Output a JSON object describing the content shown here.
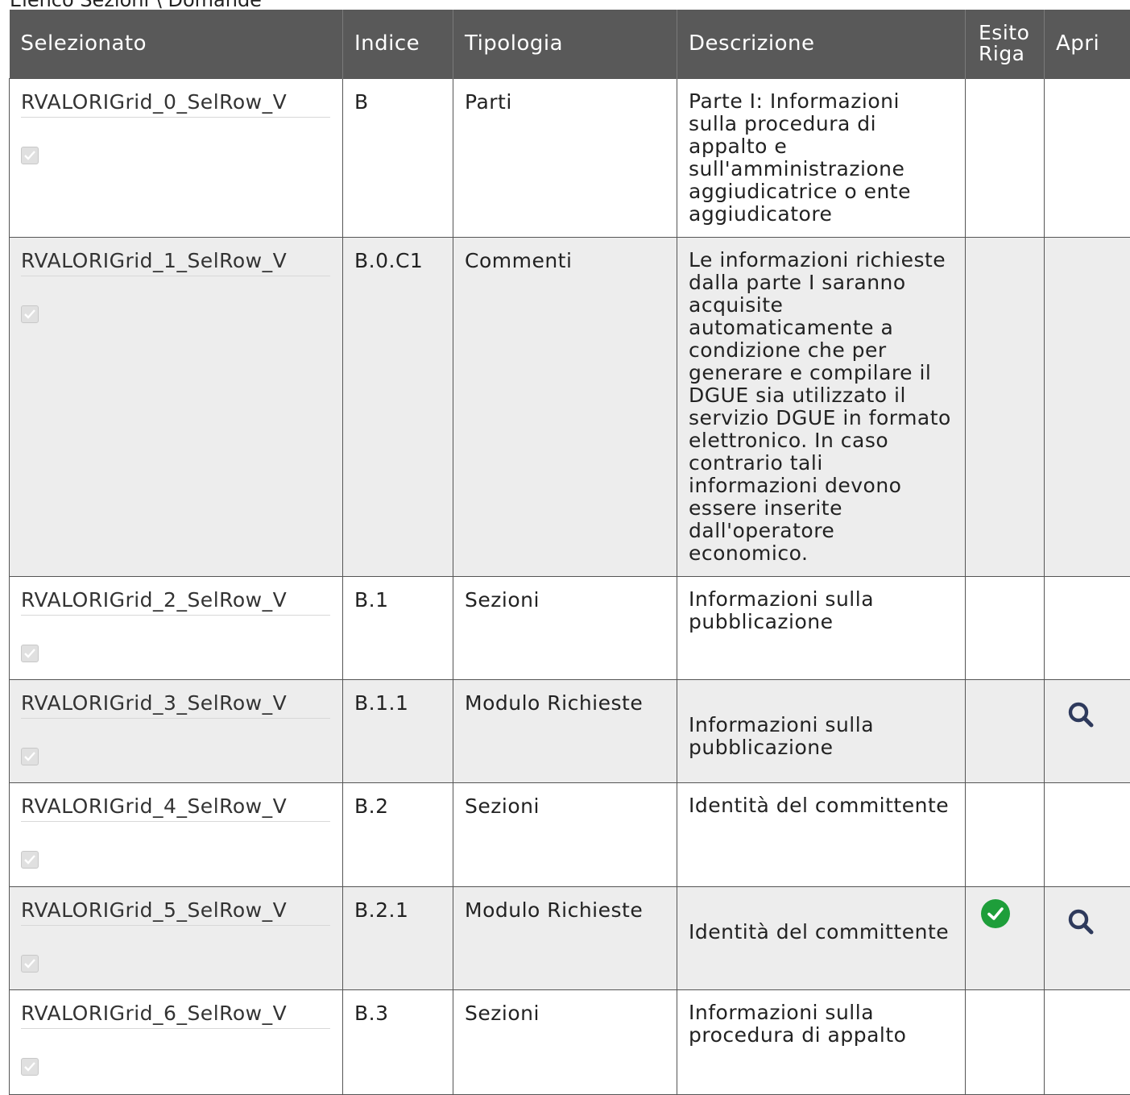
{
  "caption": "Elenco Sezioni \\ Domande",
  "headers": {
    "selezionato": "Selezionato",
    "indice": "Indice",
    "tipologia": "Tipologia",
    "descrizione": "Descrizione",
    "esito_riga_line1": "Esito",
    "esito_riga_line2": "Riga",
    "apri": "Apri"
  },
  "rows": [
    {
      "selezionato": "RVALORIGrid_0_SelRow_V",
      "checked": true,
      "indice": "B",
      "tipologia": "Parti",
      "descrizione": "Parte I: Informazioni sulla procedura di appalto e sull'amministrazione aggiudicatrice o ente aggiudicatore",
      "esito_icon": "",
      "apri_icon": ""
    },
    {
      "selezionato": "RVALORIGrid_1_SelRow_V",
      "checked": true,
      "indice": "B.0.C1",
      "tipologia": "Commenti",
      "descrizione": "Le informazioni richieste dalla parte I saranno acquisite automaticamente a condizione che per generare e compilare il DGUE sia utilizzato il servizio DGUE in formato elettronico. In caso contrario tali informazioni devono essere inserite dall'operatore economico.",
      "esito_icon": "",
      "apri_icon": ""
    },
    {
      "selezionato": "RVALORIGrid_2_SelRow_V",
      "checked": true,
      "indice": "B.1",
      "tipologia": "Sezioni",
      "descrizione": "Informazioni sulla pubblicazione",
      "esito_icon": "",
      "apri_icon": ""
    },
    {
      "selezionato": "RVALORIGrid_3_SelRow_V",
      "checked": true,
      "indice": "B.1.1",
      "tipologia": "Modulo Richieste",
      "descrizione": "Informazioni sulla pubblicazione",
      "esito_icon": "",
      "apri_icon": "magnifier-icon"
    },
    {
      "selezionato": "RVALORIGrid_4_SelRow_V",
      "checked": true,
      "indice": "B.2",
      "tipologia": "Sezioni",
      "descrizione": "Identità del committente",
      "esito_icon": "",
      "apri_icon": ""
    },
    {
      "selezionato": "RVALORIGrid_5_SelRow_V",
      "checked": true,
      "indice": "B.2.1",
      "tipologia": "Modulo Richieste",
      "descrizione": "Identità del committente",
      "esito_icon": "green-check-icon",
      "apri_icon": "magnifier-icon"
    },
    {
      "selezionato": "RVALORIGrid_6_SelRow_V",
      "checked": true,
      "indice": "B.3",
      "tipologia": "Sezioni",
      "descrizione": "Informazioni sulla procedura di appalto",
      "esito_icon": "",
      "apri_icon": ""
    }
  ],
  "colors": {
    "header_bg": "#595959",
    "even_row_bg": "#ededed",
    "ok_green": "#1e9e3a",
    "zoom_navy": "#2e3a5c"
  }
}
